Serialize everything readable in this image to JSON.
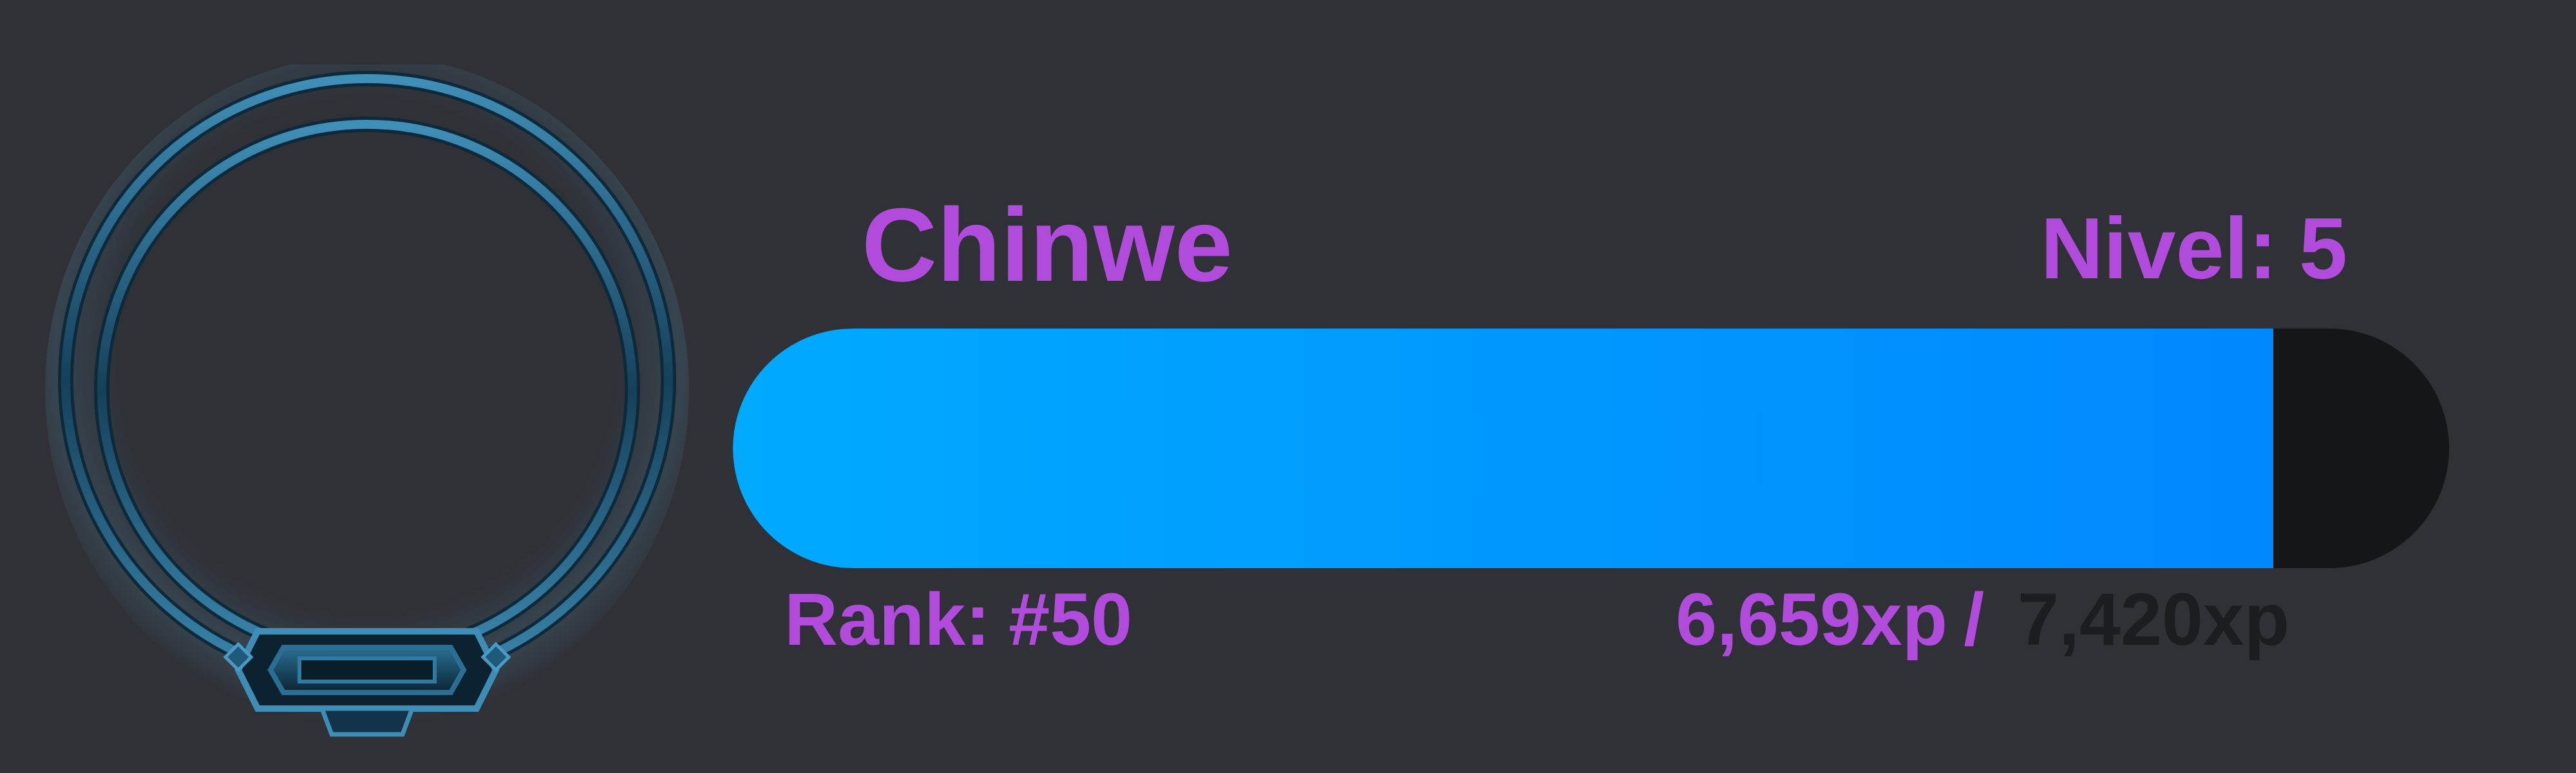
{
  "profile": {
    "username": "Chinwe",
    "level_label": "Nivel:",
    "level_value": "5",
    "rank_label": "Rank:",
    "rank_value": "#50"
  },
  "xp": {
    "current_text": "6,659xp",
    "separator": "/",
    "total_text": "7,420xp",
    "current": 6659,
    "total": 7420
  },
  "colors": {
    "background": "#2f3136",
    "accent_text": "#b04bdc",
    "bar_start": "#00aaff",
    "bar_end": "#0088ff",
    "bar_track": "#151619",
    "total_text": "#1c1d20"
  },
  "icons": {
    "avatar_frame": "ornate-ring-frame-icon"
  }
}
